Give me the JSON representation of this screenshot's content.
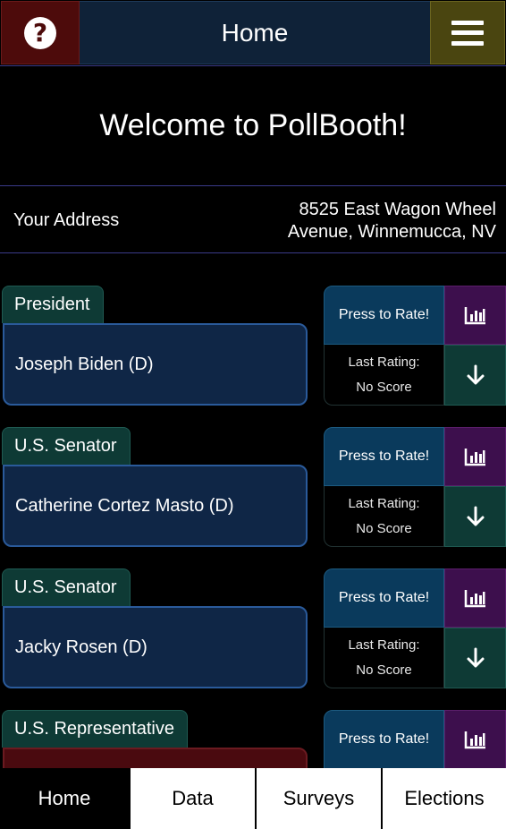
{
  "header": {
    "help_icon": "question-circle-icon",
    "title": "Home",
    "menu_icon": "hamburger-menu-icon"
  },
  "welcome": {
    "text": "Welcome to PollBooth!"
  },
  "address": {
    "label": "Your Address",
    "line1": "8525 East Wagon Wheel",
    "line2": "Avenue, Winnemucca, NV"
  },
  "races": [
    {
      "office": "President",
      "candidate": "Joseph Biden (D)",
      "rate_label": "Press to Rate!",
      "last_rating_label": "Last Rating:",
      "last_rating_value": "No Score"
    },
    {
      "office": "U.S. Senator",
      "candidate": "Catherine Cortez Masto (D)",
      "rate_label": "Press to Rate!",
      "last_rating_label": "Last Rating:",
      "last_rating_value": "No Score"
    },
    {
      "office": "U.S. Senator",
      "candidate": "Jacky Rosen (D)",
      "rate_label": "Press to Rate!",
      "last_rating_label": "Last Rating:",
      "last_rating_value": "No Score"
    },
    {
      "office": "U.S. Representative",
      "candidate": "",
      "rate_label": "Press to Rate!",
      "last_rating_label": "",
      "last_rating_value": ""
    }
  ],
  "nav": {
    "tabs": [
      {
        "label": "Home",
        "active": true
      },
      {
        "label": "Data",
        "active": false
      },
      {
        "label": "Surveys",
        "active": false
      },
      {
        "label": "Elections",
        "active": false
      }
    ]
  },
  "colors": {
    "help_bg": "#4d0b0b",
    "title_bg": "#0f2238",
    "menu_bg": "#4a4510",
    "office_tab_bg": "#0e3a35",
    "candidate_card_bg": "#0f2646",
    "rate_btn_bg": "#0a3a5c",
    "chart_btn_bg": "#3d0f4d"
  }
}
